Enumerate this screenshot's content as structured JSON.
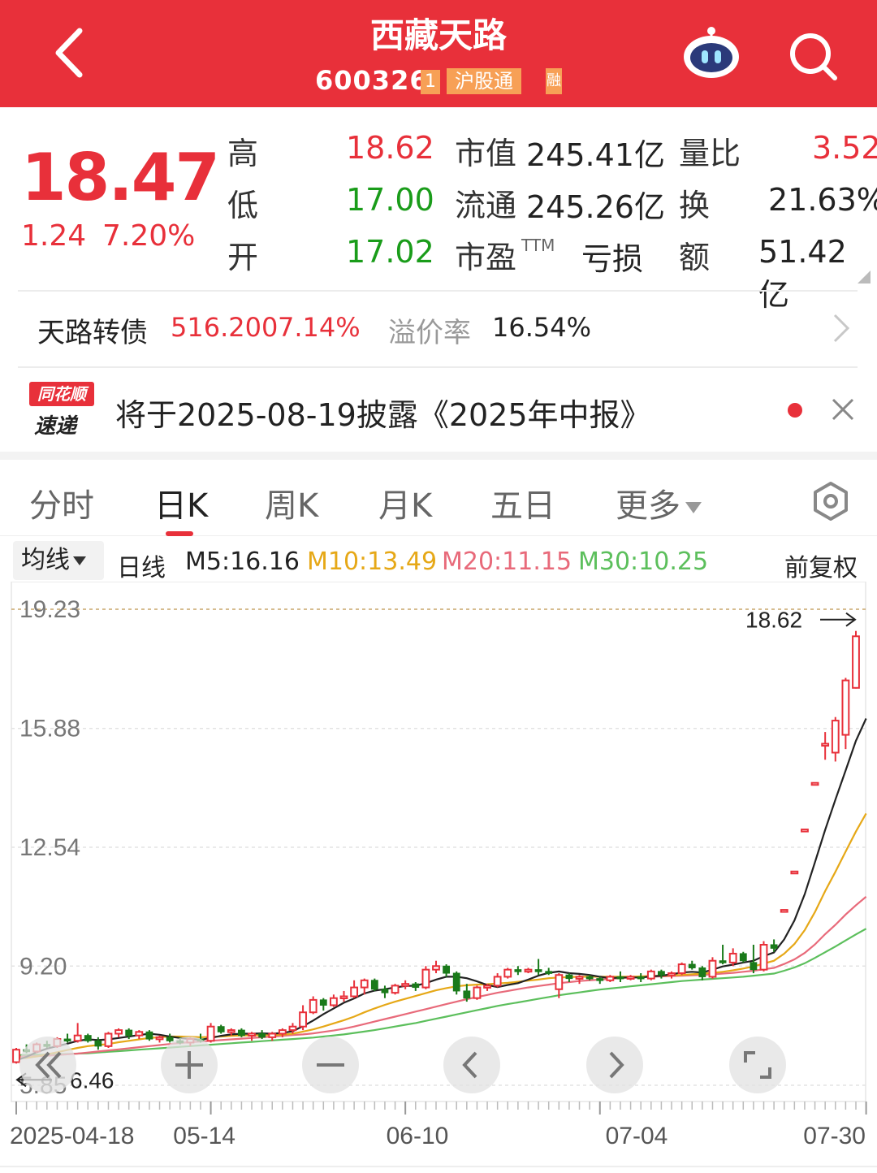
{
  "header": {
    "title": "西藏天路",
    "code": "600326",
    "badge_1": "1",
    "badge_2": "沪股通",
    "badge_3": "融"
  },
  "quote": {
    "price": "18.47",
    "change": "1.24",
    "change_pct": "7.20%",
    "high_label": "高",
    "high": "18.62",
    "low_label": "低",
    "low": "17.00",
    "open_label": "开",
    "open": "17.02",
    "mktcap_label": "市值",
    "mktcap": "245.41亿",
    "float_label": "流通",
    "float": "245.26亿",
    "pe_label": "市盈",
    "pe_sup": "TTM",
    "pe": "亏损",
    "volratio_label": "量比",
    "volratio": "3.52",
    "turnover_label": "换",
    "turnover": "21.63%",
    "amount_label": "额",
    "amount": "51.42亿"
  },
  "bond": {
    "name": "天路转债",
    "price": "516.200",
    "pct": "7.14%",
    "premium_label": "溢价率",
    "premium": "16.54%"
  },
  "notice": {
    "logo_top": "同花顺",
    "logo_bottom": "速递",
    "text": "将于2025-08-19披露《2025年中报》"
  },
  "tabs": [
    {
      "label": "分时"
    },
    {
      "label": "日K"
    },
    {
      "label": "周K"
    },
    {
      "label": "月K"
    },
    {
      "label": "五日"
    },
    {
      "label": "更多"
    }
  ],
  "ma_row": {
    "dropdown": "均线",
    "period": "日线",
    "m5": "M5:16.16",
    "m10": "M10:13.49",
    "m20": "M20:11.15",
    "m30": "M30:10.25",
    "adjust": "前复权"
  },
  "colors": {
    "brand_red": "#e8303a",
    "up": "#e8303a",
    "down": "#1a7a1a",
    "m5": "#222222",
    "m10": "#e6a817",
    "m20": "#e86a7a",
    "m30": "#5cbf5c"
  },
  "chart_data": {
    "type": "candlestick",
    "y_ticks": [
      "19.23",
      "15.88",
      "12.54",
      "9.20",
      "5.85"
    ],
    "ylim": [
      5.85,
      19.23
    ],
    "x_ticks": [
      "2025-04-18",
      "05-14",
      "06-10",
      "07-04",
      "07-30"
    ],
    "max_label": "18.62",
    "min_label": "6.46",
    "candles": [
      {
        "o": 6.5,
        "h": 6.9,
        "l": 6.46,
        "c": 6.85
      },
      {
        "o": 6.85,
        "h": 7.0,
        "l": 6.75,
        "c": 6.8
      },
      {
        "o": 6.8,
        "h": 7.05,
        "l": 6.75,
        "c": 7.0
      },
      {
        "o": 7.0,
        "h": 7.1,
        "l": 6.9,
        "c": 6.95
      },
      {
        "o": 6.95,
        "h": 7.2,
        "l": 6.9,
        "c": 7.15
      },
      {
        "o": 7.15,
        "h": 7.3,
        "l": 7.05,
        "c": 7.1
      },
      {
        "o": 7.1,
        "h": 7.6,
        "l": 7.05,
        "c": 7.25
      },
      {
        "o": 7.25,
        "h": 7.3,
        "l": 7.05,
        "c": 7.1
      },
      {
        "o": 7.1,
        "h": 7.2,
        "l": 6.85,
        "c": 6.95
      },
      {
        "o": 6.95,
        "h": 7.35,
        "l": 6.9,
        "c": 7.3
      },
      {
        "o": 7.3,
        "h": 7.45,
        "l": 7.2,
        "c": 7.4
      },
      {
        "o": 7.4,
        "h": 7.45,
        "l": 7.15,
        "c": 7.25
      },
      {
        "o": 7.25,
        "h": 7.4,
        "l": 7.15,
        "c": 7.35
      },
      {
        "o": 7.35,
        "h": 7.4,
        "l": 7.1,
        "c": 7.15
      },
      {
        "o": 7.15,
        "h": 7.25,
        "l": 7.05,
        "c": 7.2
      },
      {
        "o": 7.2,
        "h": 7.3,
        "l": 7.05,
        "c": 7.1
      },
      {
        "o": 7.1,
        "h": 7.2,
        "l": 7.0,
        "c": 7.05
      },
      {
        "o": 7.05,
        "h": 7.2,
        "l": 6.95,
        "c": 7.15
      },
      {
        "o": 7.15,
        "h": 7.3,
        "l": 7.05,
        "c": 7.1
      },
      {
        "o": 7.1,
        "h": 7.6,
        "l": 7.05,
        "c": 7.5
      },
      {
        "o": 7.5,
        "h": 7.55,
        "l": 7.3,
        "c": 7.35
      },
      {
        "o": 7.35,
        "h": 7.45,
        "l": 7.25,
        "c": 7.4
      },
      {
        "o": 7.4,
        "h": 7.45,
        "l": 7.2,
        "c": 7.25
      },
      {
        "o": 7.25,
        "h": 7.35,
        "l": 7.1,
        "c": 7.3
      },
      {
        "o": 7.3,
        "h": 7.4,
        "l": 7.15,
        "c": 7.2
      },
      {
        "o": 7.2,
        "h": 7.35,
        "l": 7.1,
        "c": 7.3
      },
      {
        "o": 7.3,
        "h": 7.45,
        "l": 7.2,
        "c": 7.4
      },
      {
        "o": 7.4,
        "h": 7.6,
        "l": 7.3,
        "c": 7.5
      },
      {
        "o": 7.5,
        "h": 8.1,
        "l": 7.4,
        "c": 7.9
      },
      {
        "o": 7.9,
        "h": 8.35,
        "l": 7.85,
        "c": 8.25
      },
      {
        "o": 8.25,
        "h": 8.3,
        "l": 7.95,
        "c": 8.1
      },
      {
        "o": 8.1,
        "h": 8.4,
        "l": 8.05,
        "c": 8.3
      },
      {
        "o": 8.3,
        "h": 8.5,
        "l": 8.2,
        "c": 8.35
      },
      {
        "o": 8.35,
        "h": 8.8,
        "l": 8.3,
        "c": 8.6
      },
      {
        "o": 8.6,
        "h": 8.85,
        "l": 8.4,
        "c": 8.8
      },
      {
        "o": 8.8,
        "h": 8.85,
        "l": 8.5,
        "c": 8.55
      },
      {
        "o": 8.55,
        "h": 8.65,
        "l": 8.3,
        "c": 8.45
      },
      {
        "o": 8.45,
        "h": 8.7,
        "l": 8.4,
        "c": 8.65
      },
      {
        "o": 8.65,
        "h": 8.8,
        "l": 8.55,
        "c": 8.7
      },
      {
        "o": 8.7,
        "h": 8.75,
        "l": 8.5,
        "c": 8.6
      },
      {
        "o": 8.6,
        "h": 9.2,
        "l": 8.55,
        "c": 9.1
      },
      {
        "o": 9.1,
        "h": 9.35,
        "l": 9.0,
        "c": 9.2
      },
      {
        "o": 9.2,
        "h": 9.25,
        "l": 8.9,
        "c": 9.0
      },
      {
        "o": 9.0,
        "h": 9.05,
        "l": 8.4,
        "c": 8.5
      },
      {
        "o": 8.5,
        "h": 8.7,
        "l": 8.2,
        "c": 8.3
      },
      {
        "o": 8.3,
        "h": 8.65,
        "l": 8.25,
        "c": 8.6
      },
      {
        "o": 8.6,
        "h": 8.7,
        "l": 8.5,
        "c": 8.65
      },
      {
        "o": 8.65,
        "h": 9.0,
        "l": 8.6,
        "c": 8.9
      },
      {
        "o": 8.9,
        "h": 9.15,
        "l": 8.85,
        "c": 9.1
      },
      {
        "o": 9.1,
        "h": 9.2,
        "l": 8.95,
        "c": 9.05
      },
      {
        "o": 9.05,
        "h": 9.15,
        "l": 9.0,
        "c": 9.1
      },
      {
        "o": 9.1,
        "h": 9.4,
        "l": 8.95,
        "c": 9.05
      },
      {
        "o": 9.05,
        "h": 9.15,
        "l": 8.95,
        "c": 9.0
      },
      {
        "o": 8.55,
        "h": 9.0,
        "l": 8.3,
        "c": 8.95
      },
      {
        "o": 8.95,
        "h": 9.0,
        "l": 8.75,
        "c": 8.85
      },
      {
        "o": 8.85,
        "h": 8.95,
        "l": 8.7,
        "c": 8.9
      },
      {
        "o": 8.9,
        "h": 8.95,
        "l": 8.8,
        "c": 8.85
      },
      {
        "o": 8.85,
        "h": 8.9,
        "l": 8.7,
        "c": 8.8
      },
      {
        "o": 8.8,
        "h": 8.95,
        "l": 8.75,
        "c": 8.9
      },
      {
        "o": 8.9,
        "h": 9.05,
        "l": 8.75,
        "c": 8.85
      },
      {
        "o": 8.85,
        "h": 8.95,
        "l": 8.8,
        "c": 8.9
      },
      {
        "o": 8.9,
        "h": 9.0,
        "l": 8.75,
        "c": 8.85
      },
      {
        "o": 8.85,
        "h": 9.1,
        "l": 8.8,
        "c": 9.05
      },
      {
        "o": 9.05,
        "h": 9.1,
        "l": 8.85,
        "c": 8.95
      },
      {
        "o": 8.95,
        "h": 9.05,
        "l": 8.85,
        "c": 9.0
      },
      {
        "o": 9.0,
        "h": 9.3,
        "l": 8.95,
        "c": 9.25
      },
      {
        "o": 9.25,
        "h": 9.35,
        "l": 9.1,
        "c": 9.15
      },
      {
        "o": 9.15,
        "h": 9.2,
        "l": 8.8,
        "c": 8.9
      },
      {
        "o": 8.9,
        "h": 9.45,
        "l": 8.85,
        "c": 9.35
      },
      {
        "o": 9.35,
        "h": 9.8,
        "l": 9.25,
        "c": 9.3
      },
      {
        "o": 9.3,
        "h": 9.7,
        "l": 9.2,
        "c": 9.55
      },
      {
        "o": 9.55,
        "h": 9.6,
        "l": 9.3,
        "c": 9.35
      },
      {
        "o": 9.3,
        "h": 9.8,
        "l": 9.0,
        "c": 9.1
      },
      {
        "o": 9.1,
        "h": 9.9,
        "l": 9.05,
        "c": 9.8
      },
      {
        "o": 9.8,
        "h": 9.95,
        "l": 9.6,
        "c": 9.7
      },
      {
        "o": 10.78,
        "h": 10.78,
        "l": 10.78,
        "c": 10.78
      },
      {
        "o": 11.86,
        "h": 11.86,
        "l": 11.86,
        "c": 11.86
      },
      {
        "o": 13.04,
        "h": 13.04,
        "l": 13.04,
        "c": 13.04
      },
      {
        "o": 14.35,
        "h": 14.35,
        "l": 14.35,
        "c": 14.35
      },
      {
        "o": 15.4,
        "h": 15.78,
        "l": 15.0,
        "c": 15.45
      },
      {
        "o": 15.2,
        "h": 16.2,
        "l": 14.95,
        "c": 16.1
      },
      {
        "o": 15.7,
        "h": 17.3,
        "l": 15.3,
        "c": 17.23
      },
      {
        "o": 17.02,
        "h": 18.62,
        "l": 17.0,
        "c": 18.47
      }
    ],
    "ma": {
      "M5": [
        6.55,
        6.65,
        6.78,
        6.88,
        6.95,
        7.02,
        7.1,
        7.14,
        7.12,
        7.14,
        7.18,
        7.22,
        7.26,
        7.3,
        7.27,
        7.22,
        7.18,
        7.15,
        7.13,
        7.18,
        7.24,
        7.28,
        7.3,
        7.3,
        7.31,
        7.3,
        7.32,
        7.37,
        7.51,
        7.67,
        7.85,
        8.01,
        8.17,
        8.29,
        8.43,
        8.51,
        8.55,
        8.6,
        8.64,
        8.65,
        8.72,
        8.82,
        8.9,
        8.9,
        8.86,
        8.77,
        8.67,
        8.61,
        8.67,
        8.72,
        8.82,
        8.93,
        9.01,
        9.05,
        9.0,
        8.98,
        8.95,
        8.9,
        8.86,
        8.88,
        8.88,
        8.88,
        8.91,
        8.93,
        8.97,
        9.02,
        9.04,
        9.02,
        9.1,
        9.19,
        9.24,
        9.3,
        9.35,
        9.48,
        9.58,
        9.95,
        10.48,
        11.22,
        12.12,
        13.03,
        13.88,
        14.7,
        15.53,
        16.16
      ],
      "M10": [
        6.6,
        6.62,
        6.66,
        6.72,
        6.78,
        6.84,
        6.9,
        6.95,
        6.98,
        7.01,
        7.06,
        7.1,
        7.14,
        7.18,
        7.2,
        7.22,
        7.22,
        7.21,
        7.2,
        7.21,
        7.22,
        7.24,
        7.25,
        7.25,
        7.26,
        7.26,
        7.27,
        7.3,
        7.36,
        7.42,
        7.5,
        7.59,
        7.68,
        7.78,
        7.9,
        8.01,
        8.11,
        8.2,
        8.28,
        8.36,
        8.44,
        8.52,
        8.58,
        8.63,
        8.66,
        8.68,
        8.69,
        8.71,
        8.73,
        8.76,
        8.79,
        8.82,
        8.86,
        8.88,
        8.89,
        8.9,
        8.9,
        8.9,
        8.9,
        8.9,
        8.9,
        8.91,
        8.92,
        8.93,
        8.94,
        8.95,
        8.97,
        8.99,
        9.01,
        9.04,
        9.08,
        9.13,
        9.19,
        9.27,
        9.35,
        9.55,
        9.82,
        10.21,
        10.72,
        11.31,
        11.85,
        12.42,
        12.98,
        13.49
      ],
      "M20": [
        6.65,
        6.66,
        6.67,
        6.68,
        6.7,
        6.72,
        6.74,
        6.77,
        6.8,
        6.83,
        6.86,
        6.89,
        6.92,
        6.95,
        6.98,
        7.01,
        7.04,
        7.06,
        7.08,
        7.1,
        7.12,
        7.14,
        7.16,
        7.18,
        7.2,
        7.22,
        7.24,
        7.26,
        7.28,
        7.31,
        7.35,
        7.39,
        7.44,
        7.5,
        7.57,
        7.64,
        7.71,
        7.78,
        7.85,
        7.92,
        7.99,
        8.06,
        8.13,
        8.2,
        8.27,
        8.33,
        8.39,
        8.45,
        8.5,
        8.55,
        8.6,
        8.64,
        8.68,
        8.72,
        8.75,
        8.78,
        8.8,
        8.82,
        8.84,
        8.86,
        8.88,
        8.89,
        8.9,
        8.91,
        8.92,
        8.93,
        8.94,
        8.95,
        8.97,
        8.99,
        9.01,
        9.04,
        9.07,
        9.11,
        9.15,
        9.26,
        9.39,
        9.57,
        9.81,
        10.1,
        10.36,
        10.65,
        10.91,
        11.15
      ],
      "M30": [
        6.7,
        6.7,
        6.71,
        6.71,
        6.72,
        6.73,
        6.74,
        6.75,
        6.77,
        6.79,
        6.81,
        6.83,
        6.85,
        6.87,
        6.89,
        6.91,
        6.93,
        6.95,
        6.97,
        6.99,
        7.01,
        7.03,
        7.05,
        7.07,
        7.09,
        7.11,
        7.13,
        7.15,
        7.17,
        7.19,
        7.22,
        7.25,
        7.28,
        7.32,
        7.36,
        7.4,
        7.45,
        7.5,
        7.55,
        7.6,
        7.66,
        7.72,
        7.78,
        7.84,
        7.9,
        7.96,
        8.02,
        8.08,
        8.13,
        8.18,
        8.23,
        8.28,
        8.33,
        8.38,
        8.42,
        8.46,
        8.5,
        8.54,
        8.57,
        8.6,
        8.63,
        8.66,
        8.69,
        8.72,
        8.75,
        8.78,
        8.8,
        8.82,
        8.84,
        8.86,
        8.88,
        8.9,
        8.93,
        8.96,
        8.99,
        9.07,
        9.16,
        9.28,
        9.43,
        9.59,
        9.75,
        9.92,
        10.09,
        10.25
      ]
    }
  }
}
